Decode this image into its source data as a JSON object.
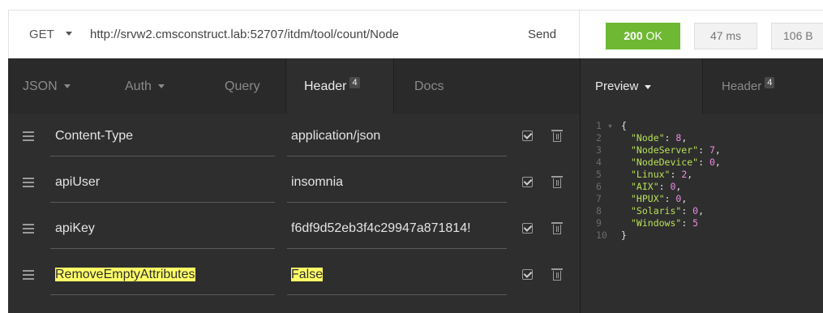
{
  "request": {
    "method": "GET",
    "url": "http://srvw2.cmsconstruct.lab:52707/itdm/tool/count/Node",
    "send_label": "Send"
  },
  "response": {
    "status_code": "200",
    "status_text": "OK",
    "time": "47 ms",
    "size": "106 B",
    "status_color": "#6fb833"
  },
  "request_tabs": [
    {
      "label": "JSON",
      "dropdown": true
    },
    {
      "label": "Auth",
      "dropdown": true
    },
    {
      "label": "Query"
    },
    {
      "label": "Header",
      "badge": "4",
      "active": true
    },
    {
      "label": "Docs"
    }
  ],
  "headers": [
    {
      "name": "Content-Type",
      "value": "application/json",
      "enabled": true
    },
    {
      "name": "apiUser",
      "value": "insomnia",
      "enabled": true
    },
    {
      "name": "apiKey",
      "value": "f6df9d52eb3f4c29947a871814!",
      "enabled": true
    },
    {
      "name": "RemoveEmptyAttributes",
      "value": "False",
      "enabled": true,
      "highlighted": true
    }
  ],
  "response_tabs": [
    {
      "label": "Preview",
      "dropdown": true,
      "active": true
    },
    {
      "label": "Header",
      "badge": "4"
    }
  ],
  "response_body": [
    {
      "n": "1",
      "text": "{"
    },
    {
      "n": "2",
      "key": "\"Node\"",
      "value": "8",
      "comma": ","
    },
    {
      "n": "3",
      "key": "\"NodeServer\"",
      "value": "7",
      "comma": ","
    },
    {
      "n": "4",
      "key": "\"NodeDevice\"",
      "value": "0",
      "comma": ","
    },
    {
      "n": "5",
      "key": "\"Linux\"",
      "value": "2",
      "comma": ","
    },
    {
      "n": "6",
      "key": "\"AIX\"",
      "value": "0",
      "comma": ","
    },
    {
      "n": "7",
      "key": "\"HPUX\"",
      "value": "0",
      "comma": ","
    },
    {
      "n": "8",
      "key": "\"Solaris\"",
      "value": "0",
      "comma": ","
    },
    {
      "n": "9",
      "key": "\"Windows\"",
      "value": "5",
      "comma": ""
    },
    {
      "n": "10",
      "text": "}"
    }
  ],
  "icons": {
    "drag": "drag-handle-icon",
    "check": "checkbox-icon",
    "delete": "trash-icon",
    "dropdown": "chevron-down-icon"
  },
  "colors": {
    "json_key": "#b8e05a",
    "json_number": "#ee8be6",
    "highlight": "#ffff66"
  }
}
